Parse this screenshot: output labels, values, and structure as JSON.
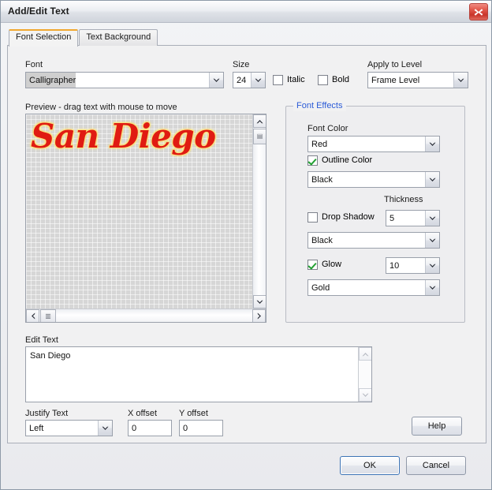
{
  "window": {
    "title": "Add/Edit Text",
    "close_icon": "close-icon"
  },
  "tabs": [
    {
      "label": "Font Selection",
      "active": true
    },
    {
      "label": "Text Background",
      "active": false
    }
  ],
  "font_section": {
    "font_label": "Font",
    "font_value": "Calligrapher",
    "size_label": "Size",
    "size_value": "24",
    "italic_label": "Italic",
    "italic_checked": false,
    "bold_label": "Bold",
    "bold_checked": false,
    "apply_label": "Apply to Level",
    "apply_value": "Frame Level"
  },
  "preview": {
    "label": "Preview - drag text with mouse to move",
    "text": "San Diego",
    "text_color": "#e01b12",
    "glow_color": "#ffe27a"
  },
  "font_effects": {
    "group_title": "Font Effects",
    "font_color_label": "Font Color",
    "font_color_value": "Red",
    "outline_color_label": "Outline Color",
    "outline_color_checked": true,
    "outline_color_value": "Black",
    "thickness_label": "Thickness",
    "drop_shadow_label": "Drop Shadow",
    "drop_shadow_checked": false,
    "drop_shadow_thickness": "5",
    "drop_shadow_color_value": "Black",
    "glow_label": "Glow",
    "glow_checked": true,
    "glow_thickness": "10",
    "glow_color_value": "Gold"
  },
  "edit_text": {
    "label": "Edit Text",
    "value": "San Diego"
  },
  "bottom_controls": {
    "justify_label": "Justify Text",
    "justify_value": "Left",
    "x_offset_label": "X offset",
    "x_offset_value": "0",
    "y_offset_label": "Y offset",
    "y_offset_value": "0",
    "help_label": "Help"
  },
  "dialog_buttons": {
    "ok_label": "OK",
    "cancel_label": "Cancel"
  }
}
